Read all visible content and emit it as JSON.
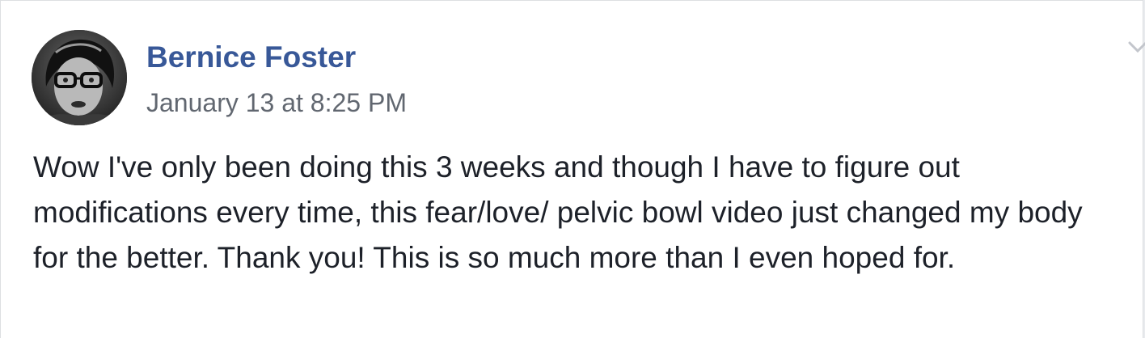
{
  "post": {
    "author": "Bernice Foster",
    "timestamp": "January 13 at 8:25 PM",
    "text": "Wow I've only been doing this 3 weeks and though I have to figure out modifications every time, this fear/love/ pelvic bowl video just changed my body for the better. Thank you! This is so much more than I even hoped for."
  },
  "icons": {
    "avatar": "profile-photo",
    "options": "chevron-down-icon"
  },
  "colors": {
    "author_link": "#385898",
    "timestamp": "#616770",
    "body_text": "#1d2129",
    "card_background": "#ffffff"
  }
}
